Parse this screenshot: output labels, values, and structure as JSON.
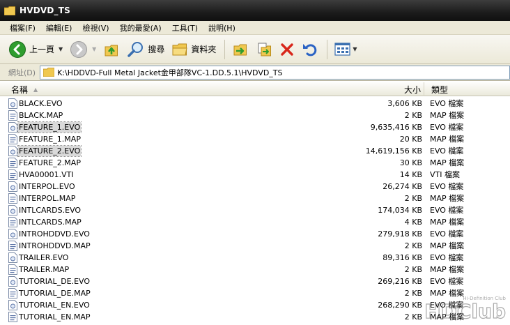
{
  "window": {
    "title": "HVDVD_TS"
  },
  "menu": [
    {
      "name": "menu-file",
      "label": "檔案(F)"
    },
    {
      "name": "menu-edit",
      "label": "編輯(E)"
    },
    {
      "name": "menu-view",
      "label": "檢視(V)"
    },
    {
      "name": "menu-favorites",
      "label": "我的最愛(A)"
    },
    {
      "name": "menu-tools",
      "label": "工具(T)"
    },
    {
      "name": "menu-help",
      "label": "說明(H)"
    }
  ],
  "toolbar": {
    "back_label": "上一頁",
    "search_label": "搜尋",
    "folders_label": "資料夾"
  },
  "address": {
    "label": "網址(D)",
    "path": "K:\\HDDVD-Full Metal Jacket金甲部隊VC-1.DD.5.1\\HVDVD_TS"
  },
  "columns": {
    "name": "名稱",
    "size": "大小",
    "type": "類型"
  },
  "files": [
    {
      "name": "BLACK.EVO",
      "size": "3,606 KB",
      "type": "EVO 檔案",
      "selected": false
    },
    {
      "name": "BLACK.MAP",
      "size": "2 KB",
      "type": "MAP 檔案",
      "selected": false
    },
    {
      "name": "FEATURE_1.EVO",
      "size": "9,635,416 KB",
      "type": "EVO 檔案",
      "selected": true
    },
    {
      "name": "FEATURE_1.MAP",
      "size": "20 KB",
      "type": "MAP 檔案",
      "selected": false
    },
    {
      "name": "FEATURE_2.EVO",
      "size": "14,619,156 KB",
      "type": "EVO 檔案",
      "selected": true
    },
    {
      "name": "FEATURE_2.MAP",
      "size": "30 KB",
      "type": "MAP 檔案",
      "selected": false
    },
    {
      "name": "HVA00001.VTI",
      "size": "14 KB",
      "type": "VTI 檔案",
      "selected": false
    },
    {
      "name": "INTERPOL.EVO",
      "size": "26,274 KB",
      "type": "EVO 檔案",
      "selected": false
    },
    {
      "name": "INTERPOL.MAP",
      "size": "2 KB",
      "type": "MAP 檔案",
      "selected": false
    },
    {
      "name": "INTLCARDS.EVO",
      "size": "174,034 KB",
      "type": "EVO 檔案",
      "selected": false
    },
    {
      "name": "INTLCARDS.MAP",
      "size": "4 KB",
      "type": "MAP 檔案",
      "selected": false
    },
    {
      "name": "INTROHDDVD.EVO",
      "size": "279,918 KB",
      "type": "EVO 檔案",
      "selected": false
    },
    {
      "name": "INTROHDDVD.MAP",
      "size": "2 KB",
      "type": "MAP 檔案",
      "selected": false
    },
    {
      "name": "TRAILER.EVO",
      "size": "89,316 KB",
      "type": "EVO 檔案",
      "selected": false
    },
    {
      "name": "TRAILER.MAP",
      "size": "2 KB",
      "type": "MAP 檔案",
      "selected": false
    },
    {
      "name": "TUTORIAL_DE.EVO",
      "size": "269,216 KB",
      "type": "EVO 檔案",
      "selected": false
    },
    {
      "name": "TUTORIAL_DE.MAP",
      "size": "2 KB",
      "type": "MAP 檔案",
      "selected": false
    },
    {
      "name": "TUTORIAL_EN.EVO",
      "size": "268,290 KB",
      "type": "EVO 檔案",
      "selected": false
    },
    {
      "name": "TUTORIAL_EN.MAP",
      "size": "2 KB",
      "type": "MAP 檔案",
      "selected": false
    }
  ],
  "watermark": {
    "text": "HDClub",
    "tagline": "Hi-Definition Club"
  },
  "colors": {
    "title_bg": "#1c1c1c",
    "chrome": "#ece9d8",
    "address_border": "#7f9db9",
    "selection": "#d9d9d9",
    "back_green": "#2f9d2f"
  }
}
